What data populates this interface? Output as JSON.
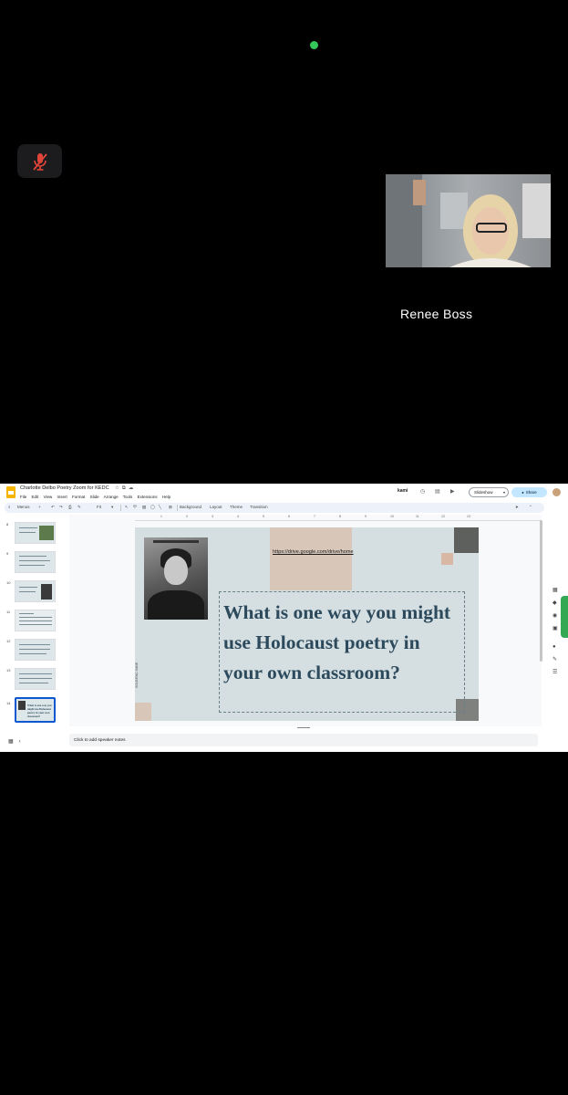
{
  "call": {
    "participant_name": "Renee Boss",
    "mic_state": "muted",
    "status_color": "#34c759",
    "mute_icon_color": "#e0453a"
  },
  "shared_screen": {
    "app": {
      "doc_title": "Charlotte Delbo Poetry Zoom for KEDC",
      "menu": [
        "File",
        "Edit",
        "View",
        "Insert",
        "Format",
        "Slide",
        "Arrange",
        "Tools",
        "Extensions",
        "Help"
      ],
      "kami_label": "kami",
      "slideshow_label": "Slideshow",
      "share_label": "Share"
    },
    "toolbar": {
      "search_label": "Menus",
      "zoom_value": "Fit",
      "background_label": "Background",
      "layout_label": "Layout",
      "theme_label": "Theme",
      "transition_label": "Transition"
    },
    "ruler_ticks": [
      "1",
      "2",
      "3",
      "4",
      "5",
      "6",
      "7",
      "8",
      "9",
      "10",
      "11",
      "12",
      "13"
    ],
    "filmstrip": {
      "slide_numbers": [
        "8",
        "9",
        "10",
        "11",
        "12",
        "13",
        "14"
      ],
      "active_slide": "14",
      "active_thumb_text": "What is one way you might use Holocaust poetry in your own classroom?"
    },
    "slide": {
      "link_text": "https://drive.google.com/drive/home",
      "question": "What is one way you might use Holocaust poetry in your own classroom?",
      "side_caption": "SOLE/ENC SANE",
      "colors": {
        "background": "#d5dfe2",
        "accent_tan": "#d8c6b8",
        "accent_dark": "#5d605c",
        "question_text": "#2c4a5c"
      }
    },
    "notes_placeholder": "Click to add speaker notes",
    "share_accent": "#c2e7ff",
    "selection_accent": "#0b57d0"
  }
}
